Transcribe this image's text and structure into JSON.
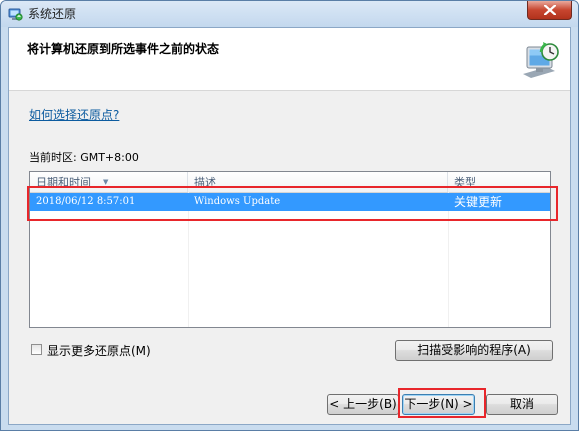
{
  "window": {
    "title": "系统还原"
  },
  "header": {
    "title": "将计算机还原到所选事件之前的状态"
  },
  "help_link": "如何选择还原点?",
  "timezone_label": "当前时区: GMT+8:00",
  "restore_points": {
    "columns": [
      "日期和时间",
      "描述",
      "类型"
    ],
    "rows": [
      {
        "datetime": "2018/06/12 8:57:01",
        "description": "Windows Update",
        "type": "关键更新"
      }
    ]
  },
  "show_more": {
    "label": "显示更多还原点(M)",
    "checked": false
  },
  "buttons": {
    "scan": "扫描受影响的程序(A)",
    "back": "< 上一步(B)",
    "next": "下一步(N) >",
    "cancel": "取消"
  },
  "colors": {
    "selection": "#3399ff",
    "annotation": "#e8262b",
    "link": "#0c5b9f"
  },
  "icons": {
    "title_icon": "system-restore-icon",
    "header_icon": "monitor-restore-icon",
    "close": "close-icon"
  }
}
